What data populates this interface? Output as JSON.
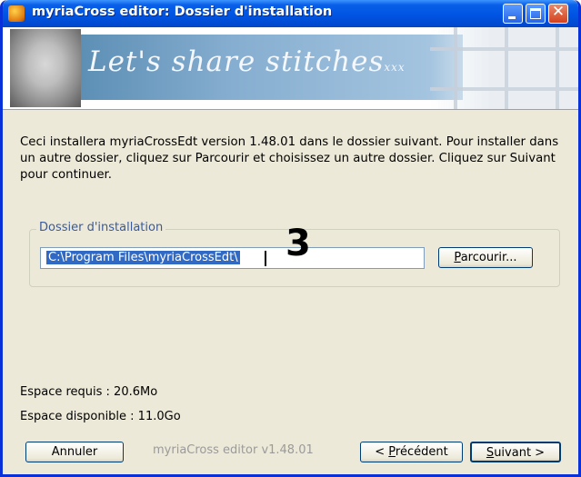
{
  "window": {
    "title": "myriaCross editor: Dossier d'installation",
    "close_glyph": "✕"
  },
  "banner": {
    "slogan": "Let's share stitches",
    "slogan_suffix": "xxx"
  },
  "description": "Ceci installera myriaCrossEdt version 1.48.01 dans le dossier suivant. Pour installer dans un autre dossier, cliquez sur Parcourir et choisissez un autre dossier. Cliquez sur Suivant pour continuer.",
  "install_folder": {
    "group_label": "Dossier d'installation",
    "path_value": "C:\\Program Files\\myriaCrossEdt\\",
    "step_marker": "3",
    "browse_button": {
      "pre": "",
      "mnemonic": "P",
      "post": "arcourir..."
    }
  },
  "space": {
    "required": "Espace requis : 20.6Mo",
    "available": "Espace disponible : 11.0Go"
  },
  "footer": {
    "cancel_label": "Annuler",
    "version_text": "myriaCross editor v1.48.01",
    "back_button": {
      "pre": "< ",
      "mnemonic": "P",
      "post": "récédent"
    },
    "next_button": {
      "pre": "",
      "mnemonic": "S",
      "post": "uivant >"
    }
  },
  "colors": {
    "title_bar": "#0054e3",
    "selection": "#316ac5",
    "window_bg": "#ece9d8",
    "group_label": "#3a5a9b"
  }
}
